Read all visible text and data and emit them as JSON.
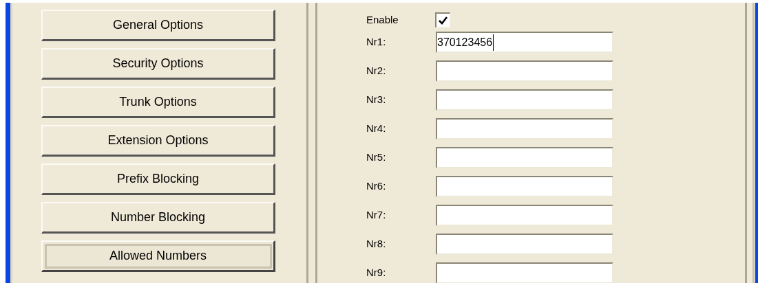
{
  "menu_buttons": [
    {
      "label": "General Options",
      "selected": false
    },
    {
      "label": "Security Options",
      "selected": false
    },
    {
      "label": "Trunk Options",
      "selected": false
    },
    {
      "label": "Extension Options",
      "selected": false
    },
    {
      "label": "Prefix Blocking",
      "selected": false
    },
    {
      "label": "Number Blocking",
      "selected": false
    },
    {
      "label": "Allowed Numbers",
      "selected": true
    }
  ],
  "enable": {
    "label": "Enable",
    "checked": true
  },
  "numbers": [
    {
      "label": "Nr1:",
      "value": "370123456",
      "focused": true
    },
    {
      "label": "Nr2:"
    },
    {
      "label": "Nr3:"
    },
    {
      "label": "Nr4:"
    },
    {
      "label": "Nr5:"
    },
    {
      "label": "Nr6:"
    },
    {
      "label": "Nr7:"
    },
    {
      "label": "Nr8:"
    },
    {
      "label": "Nr9:"
    }
  ]
}
